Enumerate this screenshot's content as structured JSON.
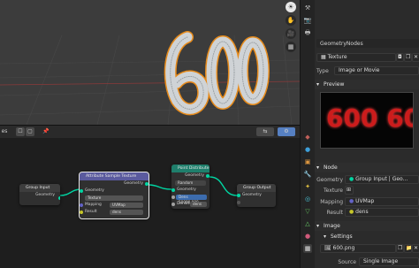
{
  "viewport": {
    "buttons": [
      "☀",
      "✋",
      "🎥",
      "▦"
    ]
  },
  "node_editor": {
    "header_buttons": [
      "es",
      "☐",
      "▢",
      "📌",
      "⇆",
      "⚙"
    ],
    "nodes": {
      "group_input": {
        "title": "Group Input",
        "output": "Geometry"
      },
      "attribute_sample_texture": {
        "title": "Attribute Sample Texture",
        "output": "Geometry",
        "input_geometry": "Geometry",
        "texture": "Texture",
        "mapping": "Mapping",
        "mapping_value": "UVMap",
        "result": "Result",
        "result_value": "dens"
      },
      "point_distribute": {
        "title": "Point Distribute",
        "output": "Geometry",
        "mode": "Random",
        "input_geometry": "Geometry",
        "dens_label": "Dens",
        "dens_value": "50000.000",
        "density_label": "Densit...",
        "density_value": "dens"
      },
      "group_output": {
        "title": "Group Output",
        "input": "Geometry"
      }
    }
  },
  "properties": {
    "node_tree": "GeometryNodes",
    "texture_name": "Texture",
    "type_label": "Type",
    "type_value": "Image or Movie",
    "preview_label": "Preview",
    "preview_text": "600 60",
    "node_panel": "Node",
    "geometry_label": "Geometry",
    "geometry_value": "Group Input | Geo...",
    "texture_label": "Texture",
    "mapping_label": "Mapping",
    "mapping_value": "UVMap",
    "result_label": "Result",
    "result_value": "dens",
    "image_panel": "Image",
    "settings_panel": "Settings",
    "image_name": "600.png",
    "source_label": "Source",
    "source_value": "Single Image"
  },
  "colors": {
    "accent_geometry": "#00d6a3",
    "node_texture_header": "#5a5a9e",
    "node_distribute_header": "#1f7f6c",
    "orange_outline": "#e68a1a",
    "preview_red": "#cc1c1c"
  }
}
